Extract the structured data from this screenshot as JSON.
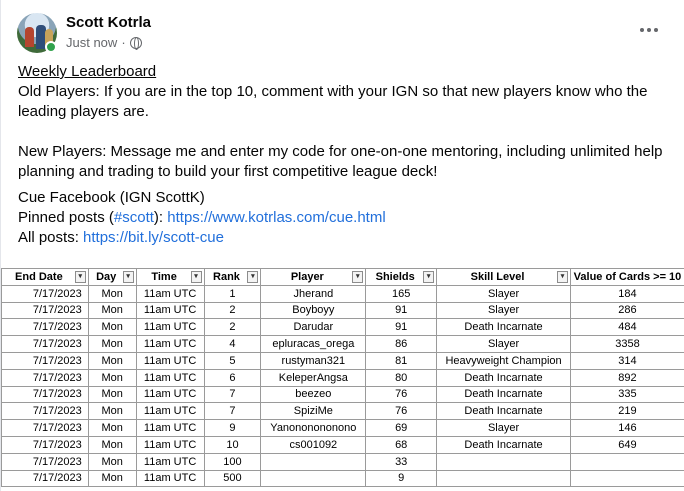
{
  "post": {
    "author": "Scott Kotrla",
    "timestamp": "Just now",
    "lines": {
      "title": "Weekly Leaderboard",
      "old_players": "Old Players: If you are in the top 10, comment with your IGN so that new players know who the leading players are.",
      "new_players": "New Players: Message me and enter my code for one-on-one mentoring, including unlimited help planning and trading to build your first competitive league deck!",
      "cue_facebook": "Cue Facebook (IGN ScottK)",
      "pinned_prefix": "Pinned posts (",
      "pinned_hashtag": "#scott",
      "pinned_mid": "): ",
      "pinned_url": "https://www.kotrlas.com/cue.html",
      "all_prefix": "All posts: ",
      "all_url": "https://bit.ly/scott-cue"
    }
  },
  "table": {
    "headers": [
      "End Date",
      "Day",
      "Time",
      "Rank",
      "Player",
      "Shields",
      "Skill Level",
      "Value of Cards >= 10"
    ],
    "header_filters": [
      "filter-icon",
      "filter-icon",
      "filter-icon",
      "dropdown-icon",
      "dropdown-icon",
      "dropdown-icon",
      "dropdown-icon",
      ""
    ],
    "rows": [
      [
        "7/17/2023",
        "Mon",
        "11am UTC",
        "1",
        "Jherand",
        "165",
        "Slayer",
        "184"
      ],
      [
        "7/17/2023",
        "Mon",
        "11am UTC",
        "2",
        "Boyboyy",
        "91",
        "Slayer",
        "286"
      ],
      [
        "7/17/2023",
        "Mon",
        "11am UTC",
        "2",
        "Darudar",
        "91",
        "Death Incarnate",
        "484"
      ],
      [
        "7/17/2023",
        "Mon",
        "11am UTC",
        "4",
        "epluracas_orega",
        "86",
        "Slayer",
        "3358"
      ],
      [
        "7/17/2023",
        "Mon",
        "11am UTC",
        "5",
        "rustyman321",
        "81",
        "Heavyweight Champion",
        "314"
      ],
      [
        "7/17/2023",
        "Mon",
        "11am UTC",
        "6",
        "KeleperAngsa",
        "80",
        "Death Incarnate",
        "892"
      ],
      [
        "7/17/2023",
        "Mon",
        "11am UTC",
        "7",
        "beezeo",
        "76",
        "Death Incarnate",
        "335"
      ],
      [
        "7/17/2023",
        "Mon",
        "11am UTC",
        "7",
        "SpiziMe",
        "76",
        "Death Incarnate",
        "219"
      ],
      [
        "7/17/2023",
        "Mon",
        "11am UTC",
        "9",
        "Yanononononono",
        "69",
        "Slayer",
        "146"
      ],
      [
        "7/17/2023",
        "Mon",
        "11am UTC",
        "10",
        "cs001092",
        "68",
        "Death Incarnate",
        "649"
      ],
      [
        "7/17/2023",
        "Mon",
        "11am UTC",
        "100",
        "",
        "33",
        "",
        ""
      ],
      [
        "7/17/2023",
        "Mon",
        "11am UTC",
        "500",
        "",
        "9",
        "",
        ""
      ]
    ]
  }
}
